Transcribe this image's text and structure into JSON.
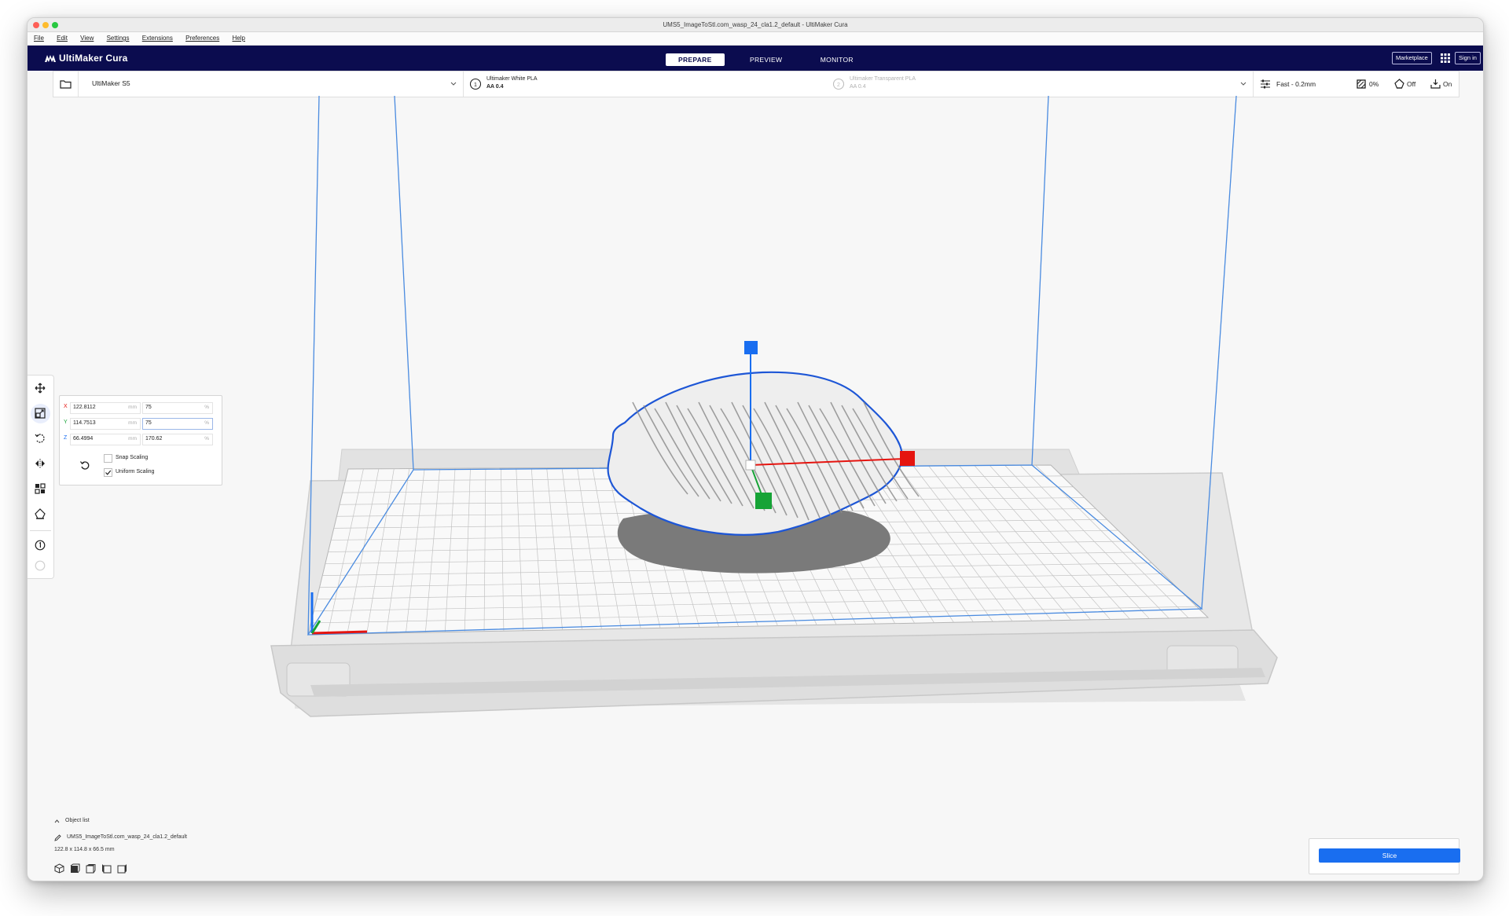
{
  "window": {
    "title": "UMS5_ImageToStl.com_wasp_24_cla1.2_default - UltiMaker Cura",
    "traffic_colors": [
      "#fe5f57",
      "#febc2e",
      "#28c840"
    ]
  },
  "menu": {
    "items": [
      {
        "label": "File"
      },
      {
        "label": "Edit"
      },
      {
        "label": "View"
      },
      {
        "label": "Settings"
      },
      {
        "label": "Extensions"
      },
      {
        "label": "Preferences"
      },
      {
        "label": "Help"
      }
    ]
  },
  "header": {
    "brand": "UltiMaker Cura",
    "tabs": [
      {
        "label": "PREPARE",
        "active": true
      },
      {
        "label": "PREVIEW",
        "active": false
      },
      {
        "label": "MONITOR",
        "active": false
      }
    ],
    "marketplace_label": "Marketplace",
    "signin_label": "Sign in",
    "apps_icon": "grid-icon"
  },
  "stage": {
    "printer_name": "UltiMaker S5",
    "extruder1": {
      "number": "1",
      "material": "Ultimaker White PLA",
      "core": "AA 0.4"
    },
    "extruder2": {
      "number": "2",
      "material": "Ultimaker Transparent PLA",
      "core": "AA 0.4"
    },
    "profile": "Fast - 0.2mm",
    "infill": "0%",
    "support": "Off",
    "adhesion": "On"
  },
  "scale_panel": {
    "x": {
      "axis": "X",
      "mm": "122.8112",
      "mm_unit": "mm",
      "pct": "75",
      "pct_unit": "%"
    },
    "y": {
      "axis": "Y",
      "mm": "114.7513",
      "mm_unit": "mm",
      "pct": "75",
      "pct_unit": "%"
    },
    "z": {
      "axis": "Z",
      "mm": "66.4994",
      "mm_unit": "mm",
      "pct": "170.62",
      "pct_unit": "%"
    },
    "snap_scaling_label": "Snap Scaling",
    "snap_scaling_checked": false,
    "uniform_scaling_label": "Uniform Scaling",
    "uniform_scaling_checked": true
  },
  "object_list": {
    "header": "Object list",
    "object_name": "UMS5_ImageToStl.com_wasp_24_cla1.2_default",
    "dimensions": "122.8 x 114.8 x 66.5 mm"
  },
  "slice": {
    "label": "Slice"
  },
  "colors": {
    "header_bg": "#0b0c4f",
    "accent_blue": "#196ef0",
    "axis_x": "#e5140f",
    "axis_y": "#16a336",
    "axis_z": "#196ef0",
    "build_volume_line": "#4a8be0"
  }
}
